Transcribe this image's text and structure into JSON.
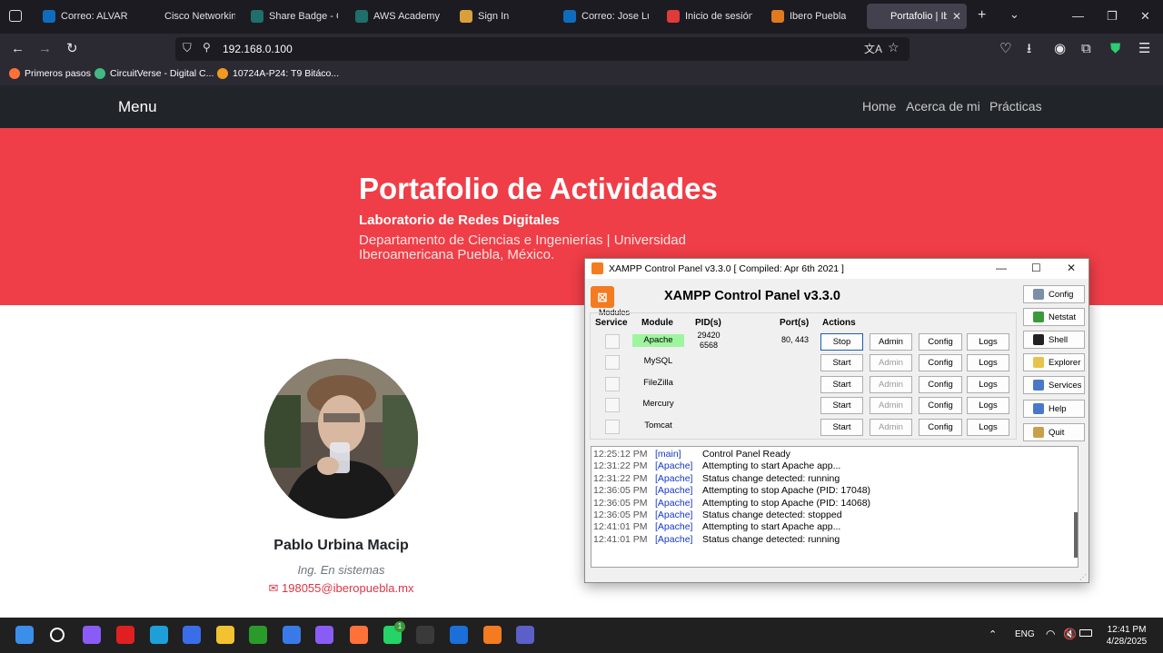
{
  "browser": {
    "tabs": [
      {
        "label": "Correo: ALVAREZ",
        "color": "#0f6cbd"
      },
      {
        "label": "Cisco Networking",
        "color": "#1c1b22"
      },
      {
        "label": "Share Badge - Cre",
        "color": "#1f6f6a"
      },
      {
        "label": "AWS Academy Gr",
        "color": "#1f6f6a"
      },
      {
        "label": "Sign In",
        "color": "#d9a03a"
      },
      {
        "label": "Correo: Jose Luis",
        "color": "#0f6cbd"
      },
      {
        "label": "Inicio de sesión er",
        "color": "#e03a3a"
      },
      {
        "label": "Ibero Puebla",
        "color": "#e07a1f"
      },
      {
        "label": "Portafolio | Ibero P",
        "color": "#42414d"
      }
    ],
    "url": "192.168.0.100",
    "bookmarks": [
      {
        "label": "Primeros pasos",
        "color": "#ff7139"
      },
      {
        "label": "CircuitVerse - Digital C...",
        "color": "#42b983"
      },
      {
        "label": "10724A-P24: T9 Bitáco...",
        "color": "#f29a1f"
      }
    ]
  },
  "site": {
    "brand": "Menu",
    "nav": [
      "Home",
      "Acerca de mi",
      "Prácticas"
    ],
    "hero_title": "Portafolio de Actividades",
    "hero_subtitle": "Laboratorio de Redes Digitales",
    "hero_dept": "Departamento de Ciencias e Ingenierías | Universidad Iberoamericana Puebla, México.",
    "person_name": "Pablo Urbina Macip",
    "person_title": "Ing. En sistemas",
    "person_email": "198055@iberopuebla.mx"
  },
  "xampp": {
    "window_title": "XAMPP Control Panel v3.3.0   [ Compiled: Apr 6th 2021 ]",
    "heading": "XAMPP Control Panel v3.3.0",
    "modules_label": "Modules",
    "headers": {
      "service": "Service",
      "module": "Module",
      "pid": "PID(s)",
      "port": "Port(s)",
      "actions": "Actions"
    },
    "modules": [
      {
        "name": "Apache",
        "pid": "29420\n6568",
        "port": "80, 443",
        "action": "Stop",
        "admin": "Admin",
        "config": "Config",
        "logs": "Logs",
        "running": true
      },
      {
        "name": "MySQL",
        "pid": "",
        "port": "",
        "action": "Start",
        "admin": "Admin",
        "config": "Config",
        "logs": "Logs",
        "running": false
      },
      {
        "name": "FileZilla",
        "pid": "",
        "port": "",
        "action": "Start",
        "admin": "Admin",
        "config": "Config",
        "logs": "Logs",
        "running": false
      },
      {
        "name": "Mercury",
        "pid": "",
        "port": "",
        "action": "Start",
        "admin": "Admin",
        "config": "Config",
        "logs": "Logs",
        "running": false
      },
      {
        "name": "Tomcat",
        "pid": "",
        "port": "",
        "action": "Start",
        "admin": "Admin",
        "config": "Config",
        "logs": "Logs",
        "running": false
      }
    ],
    "side_buttons": [
      {
        "label": "Config",
        "icon": "wrench-icon",
        "color": "#7a8fa8"
      },
      {
        "label": "Netstat",
        "icon": "globe-icon",
        "color": "#3a9a3a"
      },
      {
        "label": "Shell",
        "icon": "terminal-icon",
        "color": "#222222"
      },
      {
        "label": "Explorer",
        "icon": "folder-icon",
        "color": "#e8c34a"
      },
      {
        "label": "Services",
        "icon": "services-icon",
        "color": "#4a78c8"
      },
      {
        "label": "Help",
        "icon": "help-icon",
        "color": "#4a78c8"
      },
      {
        "label": "Quit",
        "icon": "quit-icon",
        "color": "#c8a04a"
      }
    ],
    "log": [
      {
        "time": "12:25:12 PM",
        "module": "[main]",
        "msg": "Control Panel Ready"
      },
      {
        "time": "12:31:22 PM",
        "module": "[Apache]",
        "msg": "Attempting to start Apache app..."
      },
      {
        "time": "12:31:22 PM",
        "module": "[Apache]",
        "msg": "Status change detected: running"
      },
      {
        "time": "12:36:05 PM",
        "module": "[Apache]",
        "msg": "Attempting to stop Apache (PID: 17048)"
      },
      {
        "time": "12:36:05 PM",
        "module": "[Apache]",
        "msg": "Attempting to stop Apache (PID: 14068)"
      },
      {
        "time": "12:36:05 PM",
        "module": "[Apache]",
        "msg": "Status change detected: stopped"
      },
      {
        "time": "12:41:01 PM",
        "module": "[Apache]",
        "msg": "Attempting to start Apache app..."
      },
      {
        "time": "12:41:01 PM",
        "module": "[Apache]",
        "msg": "Status change detected: running"
      }
    ]
  },
  "taskbar": {
    "apps": [
      {
        "name": "start-icon",
        "color": "#3b8eea"
      },
      {
        "name": "search-icon",
        "color": "#202020"
      },
      {
        "name": "copilot-icon",
        "color": "#8a5cf6"
      },
      {
        "name": "youtube-icon",
        "color": "#e02020"
      },
      {
        "name": "edge-icon",
        "color": "#1f9fd8"
      },
      {
        "name": "copilot-app-icon",
        "color": "#3a6ee8"
      },
      {
        "name": "file-explorer-icon",
        "color": "#f2c230"
      },
      {
        "name": "xbox-icon",
        "color": "#2a9a2a"
      },
      {
        "name": "arc-icon",
        "color": "#3a7ae8"
      },
      {
        "name": "photos-icon",
        "color": "#8a5cf6"
      },
      {
        "name": "firefox-icon",
        "color": "#ff7139"
      },
      {
        "name": "whatsapp-icon",
        "color": "#25d366"
      },
      {
        "name": "terminal-icon",
        "color": "#3a3a3a"
      },
      {
        "name": "defender-icon",
        "color": "#1a6fd8"
      },
      {
        "name": "xampp-icon",
        "color": "#f47b20"
      },
      {
        "name": "teams-icon",
        "color": "#5b5fc7"
      }
    ],
    "whatsapp_badge": "1",
    "language": "ENG",
    "time": "12:41 PM",
    "date": "4/28/2025"
  }
}
